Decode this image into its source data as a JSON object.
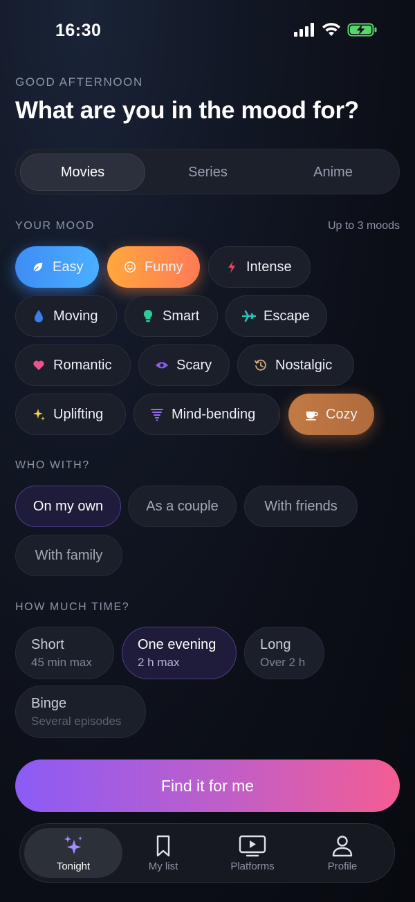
{
  "status": {
    "time": "16:30"
  },
  "header": {
    "greeting": "GOOD AFTERNOON",
    "title": "What are you in the mood for?"
  },
  "segments": [
    "Movies",
    "Series",
    "Anime"
  ],
  "mood": {
    "label": "YOUR MOOD",
    "hint": "Up to 3 moods",
    "chips": [
      "Easy",
      "Funny",
      "Intense",
      "Moving",
      "Smart",
      "Escape",
      "Romantic",
      "Scary",
      "Nostalgic",
      "Uplifting",
      "Mind-bending",
      "Cozy"
    ]
  },
  "who": {
    "label": "WHO WITH?",
    "options": [
      "On my own",
      "As a couple",
      "With friends",
      "With family"
    ]
  },
  "time": {
    "label": "HOW MUCH TIME?",
    "options": [
      {
        "title": "Short",
        "sub": "45 min max"
      },
      {
        "title": "One evening",
        "sub": "2 h max"
      },
      {
        "title": "Long",
        "sub": "Over 2 h"
      },
      {
        "title": "Binge",
        "sub": "Several episodes"
      }
    ]
  },
  "cta": {
    "label": "Find it for me"
  },
  "tabs": [
    "Tonight",
    "My list",
    "Platforms",
    "Profile"
  ],
  "colors": {
    "accent_start": "#8b5cf6",
    "accent_end": "#f45d93",
    "easy": "#49b0ff",
    "funny": "#ff8a4c",
    "cozy": "#c27a45"
  }
}
